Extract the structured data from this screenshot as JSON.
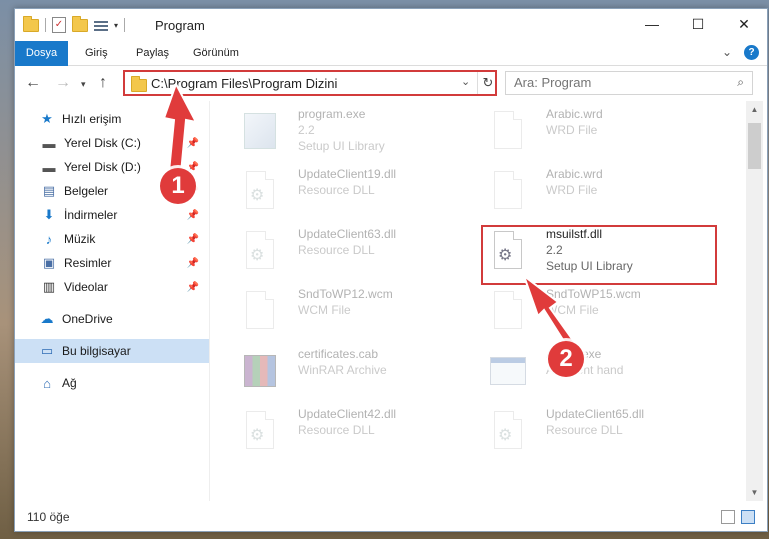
{
  "window": {
    "title": "Program",
    "controls": {
      "minimize": "—",
      "maximize": "☐",
      "close": "✕"
    }
  },
  "ribbon": {
    "tabs": [
      "Dosya",
      "Giriş",
      "Paylaş",
      "Görünüm"
    ],
    "accent": "#1979ca"
  },
  "address": {
    "path": "C:\\Program Files\\Program Dizini",
    "search_placeholder": "Ara: Program"
  },
  "nav": {
    "quick_access": "Hızlı erişim",
    "pinned": [
      {
        "label": "Yerel Disk (C:)",
        "icon": "drive-icon"
      },
      {
        "label": "Yerel Disk (D:)",
        "icon": "drive-icon"
      },
      {
        "label": "Belgeler",
        "icon": "documents-icon"
      },
      {
        "label": "İndirmeler",
        "icon": "downloads-icon"
      },
      {
        "label": "Müzik",
        "icon": "music-icon"
      },
      {
        "label": "Resimler",
        "icon": "pictures-icon"
      },
      {
        "label": "Videolar",
        "icon": "videos-icon"
      }
    ],
    "onedrive": "OneDrive",
    "this_pc": "Bu bilgisayar",
    "network": "Ağ"
  },
  "files": [
    {
      "name": "program.exe",
      "sub1": "2.2",
      "sub2": "Setup UI Library",
      "icon": "exe-icon",
      "faded": true
    },
    {
      "name": "Arabic.wrd",
      "sub1": "WRD File",
      "sub2": "",
      "icon": "file-icon",
      "faded": true
    },
    {
      "name": "UpdateClient19.dll",
      "sub1": "Resource DLL",
      "sub2": "",
      "icon": "dll-icon",
      "faded": true
    },
    {
      "name": "Arabic.wrd",
      "sub1": "WRD File",
      "sub2": "",
      "icon": "file-icon",
      "faded": true
    },
    {
      "name": "UpdateClient63.dll",
      "sub1": "Resource DLL",
      "sub2": "",
      "icon": "dll-icon",
      "faded": true
    },
    {
      "name": "msuilstf.dll",
      "sub1": "2.2",
      "sub2": "Setup UI Library",
      "icon": "dll-icon",
      "faded": false
    },
    {
      "name": "SndToWP12.wcm",
      "sub1": "WCM File",
      "sub2": "",
      "icon": "file-icon",
      "faded": true
    },
    {
      "name": "SndToWP15.wcm",
      "sub1": "WCM File",
      "sub2": "",
      "icon": "file-icon",
      "faded": true
    },
    {
      "name": "certificates.cab",
      "sub1": "WinRAR Archive",
      "sub2": "",
      "icon": "archive-icon",
      "faded": true
    },
    {
      "name": "AE..Tl.exe",
      "sub1": "A...event hand",
      "sub2": "",
      "icon": "app-icon",
      "faded": true
    },
    {
      "name": "UpdateClient42.dll",
      "sub1": "Resource DLL",
      "sub2": "",
      "icon": "dll-icon",
      "faded": true
    },
    {
      "name": "UpdateClient65.dll",
      "sub1": "Resource DLL",
      "sub2": "",
      "icon": "dll-icon",
      "faded": true
    }
  ],
  "status": {
    "count": "110 öğe"
  },
  "annotations": {
    "badge1": "1",
    "badge2": "2",
    "color": "#e03b3b"
  }
}
